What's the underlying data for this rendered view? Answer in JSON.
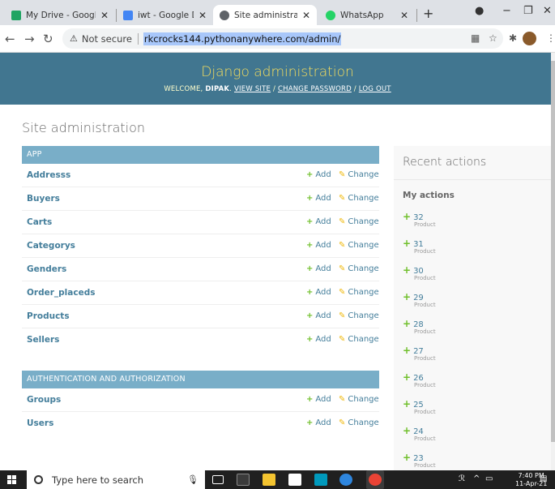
{
  "browser": {
    "tabs": [
      {
        "title": "My Drive - Google Driv",
        "color": "#1fa463"
      },
      {
        "title": "iwt - Google Docs",
        "color": "#4285f4"
      },
      {
        "title": "Site administration | Dj",
        "color": "#5f6368"
      },
      {
        "title": "WhatsApp",
        "color": "#25d366"
      }
    ],
    "security_label": "Not secure",
    "url": "rkcrocks144.pythonanywhere.com/admin/"
  },
  "header": {
    "brand": "Django administration",
    "welcome": "Welcome,",
    "username": "Dipak",
    "view_site": "View site",
    "change_password": "Change password",
    "log_out": "Log out"
  },
  "page_title": "Site administration",
  "add_label": "Add",
  "change_label": "Change",
  "modules": [
    {
      "caption": "App",
      "models": [
        "Addresss",
        "Buyers",
        "Carts",
        "Categorys",
        "Genders",
        "Order_placeds",
        "Products",
        "Sellers"
      ]
    },
    {
      "caption": "Authentication and Authorization",
      "models": [
        "Groups",
        "Users"
      ]
    }
  ],
  "recent": {
    "title": "Recent actions",
    "subtitle": "My actions",
    "items": [
      {
        "num": "32",
        "type": "Product"
      },
      {
        "num": "31",
        "type": "Product"
      },
      {
        "num": "30",
        "type": "Product"
      },
      {
        "num": "29",
        "type": "Product"
      },
      {
        "num": "28",
        "type": "Product"
      },
      {
        "num": "27",
        "type": "Product"
      },
      {
        "num": "26",
        "type": "Product"
      },
      {
        "num": "25",
        "type": "Product"
      },
      {
        "num": "24",
        "type": "Product"
      },
      {
        "num": "23",
        "type": "Product"
      }
    ]
  },
  "taskbar": {
    "search_placeholder": "Type here to search",
    "time": "7:40 PM",
    "date": "11-Apr-21"
  }
}
